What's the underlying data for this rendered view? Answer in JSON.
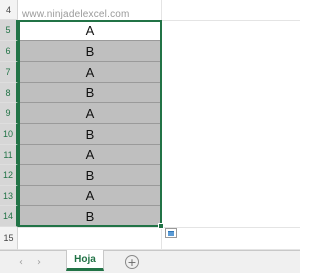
{
  "watermark": "www.ninjadelexcel.com",
  "rows": [
    {
      "num": "4",
      "value": ""
    },
    {
      "num": "5",
      "value": "A"
    },
    {
      "num": "6",
      "value": "B"
    },
    {
      "num": "7",
      "value": "A"
    },
    {
      "num": "8",
      "value": "B"
    },
    {
      "num": "9",
      "value": "A"
    },
    {
      "num": "10",
      "value": "B"
    },
    {
      "num": "11",
      "value": "A"
    },
    {
      "num": "12",
      "value": "B"
    },
    {
      "num": "13",
      "value": "A"
    },
    {
      "num": "14",
      "value": "B"
    },
    {
      "num": "15",
      "value": ""
    }
  ],
  "tabbar": {
    "prev_icon": "‹",
    "next_icon": "›",
    "sheet_name": "Hoja",
    "add_icon": "+"
  },
  "colors": {
    "accent": "#217346",
    "selection_fill": "#bfbfbf"
  }
}
